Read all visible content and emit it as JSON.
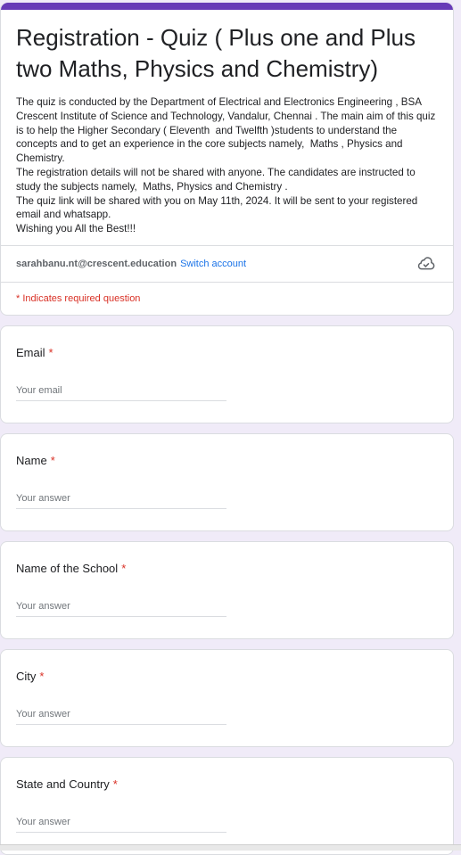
{
  "header": {
    "title": "Registration - Quiz ( Plus one and Plus two Maths, Physics and Chemistry)",
    "description": "The quiz is conducted by the Department of Electrical and Electronics Engineering , BSA Crescent Institute of Science and Technology, Vandalur, Chennai . The main aim of this quiz is to help the Higher Secondary ( Eleventh  and Twelfth )students to understand the concepts and to get an experience in the core subjects namely,  Maths , Physics and Chemistry.\nThe registration details will not be shared with anyone. The candidates are instructed to study the subjects namely,  Maths, Physics and Chemistry .\nThe quiz link will be shared with you on May 11th, 2024. It will be sent to your registered email and whatsapp.\nWishing you All the Best!!!"
  },
  "account": {
    "email": "sarahbanu.nt@crescent.education",
    "switch_label": "Switch account",
    "icon": "cloud-icon"
  },
  "required_note": "* Indicates required question",
  "questions": [
    {
      "label": "Email",
      "required_mark": "*",
      "placeholder": "Your email",
      "value": ""
    },
    {
      "label": "Name",
      "required_mark": "*",
      "placeholder": "Your answer",
      "value": ""
    },
    {
      "label": "Name of the School",
      "required_mark": "*",
      "placeholder": "Your answer",
      "value": ""
    },
    {
      "label": "City",
      "required_mark": "*",
      "placeholder": "Your answer",
      "value": ""
    },
    {
      "label": "State  and Country",
      "required_mark": "*",
      "placeholder": "Your answer",
      "value": ""
    }
  ],
  "colors": {
    "accent": "#673ab7",
    "background": "#f0ebf8",
    "required": "#d93025",
    "link": "#1a73e8"
  }
}
